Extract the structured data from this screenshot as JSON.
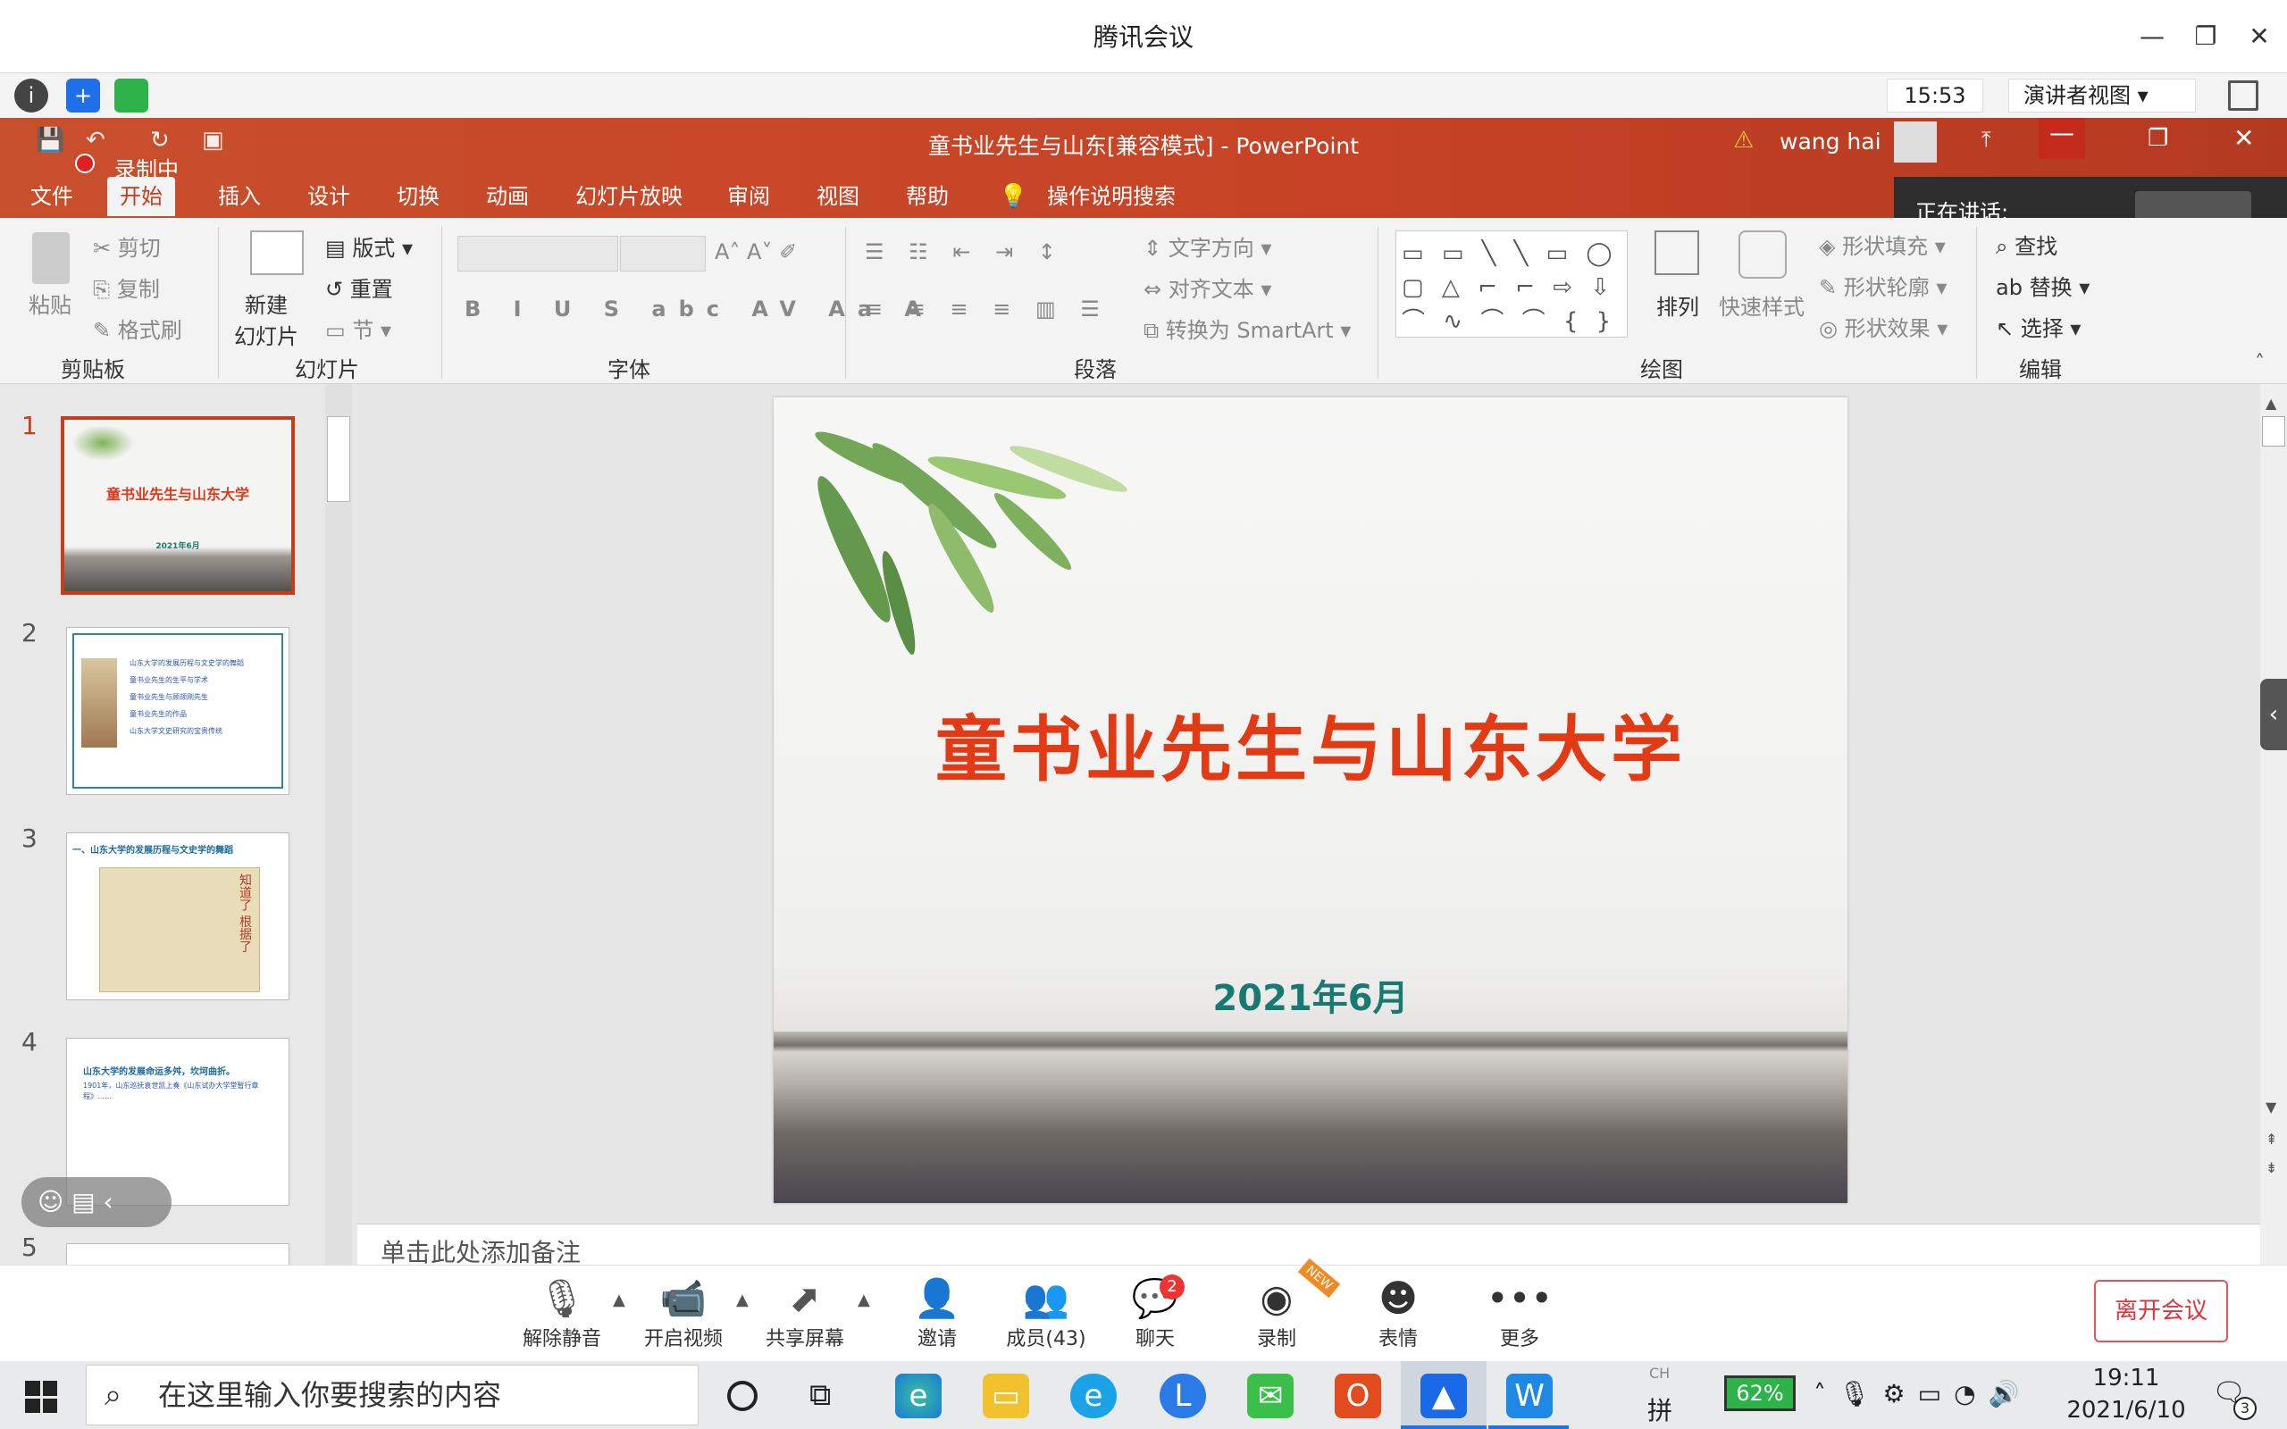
{
  "window": {
    "title": "腾讯会议"
  },
  "meeting": {
    "time": "15:53",
    "presenter_view": "演讲者视图"
  },
  "ppt": {
    "title": "童书业先生与山东[兼容模式]  -  PowerPoint",
    "user": "wang hai",
    "recording": "录制中",
    "tabs": [
      "文件",
      "开始",
      "插入",
      "设计",
      "切换",
      "动画",
      "幻灯片放映",
      "审阅",
      "视图",
      "帮助"
    ],
    "tell_me": "操作说明搜索"
  },
  "speaking": "正在讲话:",
  "ribbon": {
    "paste": "粘贴",
    "cut": "剪切",
    "copy": "复制",
    "format_painter": "格式刷",
    "new_slide": "新建\n幻灯片",
    "layout": "版式",
    "reset": "重置",
    "section": "节",
    "text_dir": "文字方向",
    "align_text": "对齐文本",
    "smartart": "转换为 SmartArt",
    "arrange": "排列",
    "quick_styles": "快速样式",
    "shape_fill": "形状填充",
    "shape_outline": "形状轮廓",
    "shape_effects": "形状效果",
    "find": "查找",
    "replace": "替换",
    "select": "选择",
    "groups": [
      "剪贴板",
      "幻灯片",
      "字体",
      "段落",
      "绘图",
      "编辑"
    ]
  },
  "thumbs": [
    {
      "num": "1",
      "title": "童书业先生与山东大学",
      "date": "2021年6月"
    },
    {
      "num": "2",
      "items": [
        "山东大学的发展历程与文史学的舞蹈",
        "童书业先生的生平与学术",
        "童书业先生与顾颉刚先生",
        "童书业先生的作品",
        "山东大学文史研究的宝贵传统"
      ]
    },
    {
      "num": "3",
      "title": "一、山东大学的发展历程与文史学的舞蹈",
      "img": "知道了 根据了"
    },
    {
      "num": "4",
      "head": "山东大学的发展命运多舛，坎坷曲折。",
      "body": "1901年，山东巡抚袁世凯上奏《山东试办大学堂暂行章程》……"
    },
    {
      "num": "5"
    }
  ],
  "slide": {
    "title": "童书业先生与山东大学",
    "date": "2021年6月"
  },
  "notes": "单击此处添加备注",
  "toolbar": [
    {
      "label": "解除静音",
      "icon": "mic-muted-icon"
    },
    {
      "label": "开启视频",
      "icon": "video-off-icon"
    },
    {
      "label": "共享屏幕",
      "icon": "share-icon"
    },
    {
      "label": "邀请",
      "icon": "invite-icon"
    },
    {
      "label": "成员(43)",
      "icon": "members-icon"
    },
    {
      "label": "聊天",
      "icon": "chat-icon",
      "badge": "2"
    },
    {
      "label": "录制",
      "icon": "record-icon",
      "tag": "NEW"
    },
    {
      "label": "表情",
      "icon": "emoji-icon"
    },
    {
      "label": "更多",
      "icon": "more-icon"
    }
  ],
  "leave": "离开会议",
  "taskbar": {
    "search": "在这里输入你要搜索的内容",
    "battery": "62%",
    "ime_top": "CH",
    "ime": "拼",
    "time": "19:11",
    "date": "2021/6/10",
    "notif": "3"
  }
}
